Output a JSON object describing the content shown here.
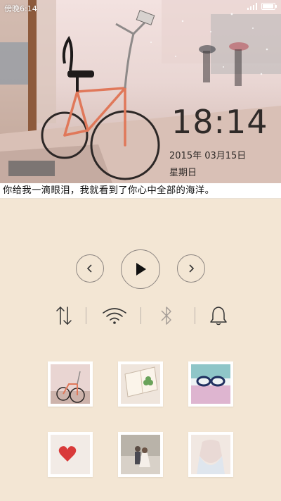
{
  "status_bar": {
    "time": "傍晚6:14"
  },
  "lockscreen": {
    "clock": "18:14",
    "date": "2015年  03月15日",
    "weekday": "星期日"
  },
  "quote": "你给我一滴眼泪，我就看到了你心中全部的海洋。",
  "player": {
    "prev_icon": "chevron-left-icon",
    "play_icon": "play-icon",
    "next_icon": "chevron-right-icon"
  },
  "toggles": [
    {
      "icon": "mobile-data-icon"
    },
    {
      "icon": "wifi-icon"
    },
    {
      "icon": "bluetooth-icon"
    },
    {
      "icon": "bell-icon"
    }
  ],
  "thumbnails": [
    {
      "subject": "bicycle"
    },
    {
      "subject": "clover-book"
    },
    {
      "subject": "glasses"
    },
    {
      "subject": "red-heart"
    },
    {
      "subject": "couple"
    },
    {
      "subject": "girl-dress"
    }
  ],
  "colors": {
    "background": "#f3e6d4",
    "accent_text": "#2f2a28",
    "bike_frame": "#e0785a"
  }
}
